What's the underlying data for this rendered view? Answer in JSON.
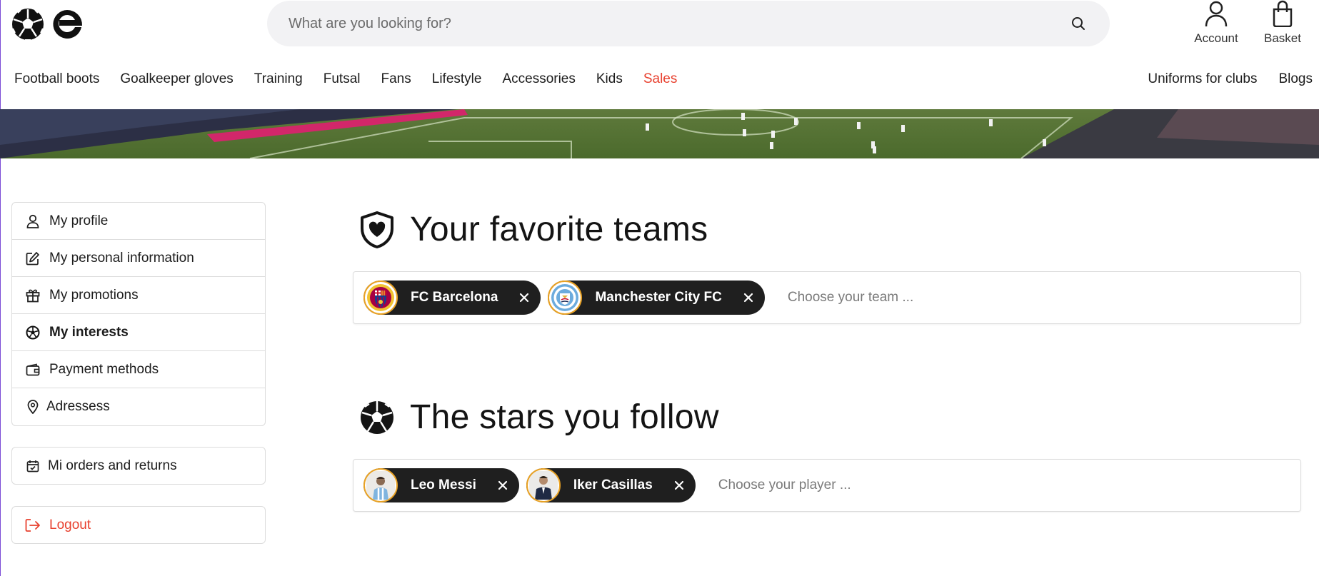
{
  "search": {
    "placeholder": "What are you looking for?"
  },
  "header": {
    "account_label": "Account",
    "basket_label": "Basket"
  },
  "nav": {
    "left": [
      "Football boots",
      "Goalkeeper gloves",
      "Training",
      "Futsal",
      "Fans",
      "Lifestyle",
      "Accessories",
      "Kids",
      "Sales"
    ],
    "right": [
      "Uniforms for clubs",
      "Blogs"
    ]
  },
  "sidebar": {
    "items": [
      {
        "label": "My profile",
        "icon": "user-icon"
      },
      {
        "label": "My personal information",
        "icon": "edit-icon"
      },
      {
        "label": "My promotions",
        "icon": "gift-icon"
      },
      {
        "label": "My interests",
        "icon": "football-icon",
        "active": true
      },
      {
        "label": "Payment methods",
        "icon": "wallet-icon"
      },
      {
        "label": "Adressess",
        "icon": "location-pin-icon"
      }
    ],
    "orders_label": "Mi orders and returns",
    "logout_label": "Logout"
  },
  "teams": {
    "title": "Your favorite teams",
    "chips": [
      "FC Barcelona",
      "Manchester City FC"
    ],
    "placeholder": "Choose your team ..."
  },
  "stars": {
    "title": "The stars you follow",
    "chips": [
      "Leo Messi",
      "Iker Casillas"
    ],
    "placeholder": "Choose your player ..."
  },
  "colors": {
    "accent_red": "#e8412f",
    "chip_bg": "#1f1f1f",
    "avatar_ring": "#e9a224"
  }
}
